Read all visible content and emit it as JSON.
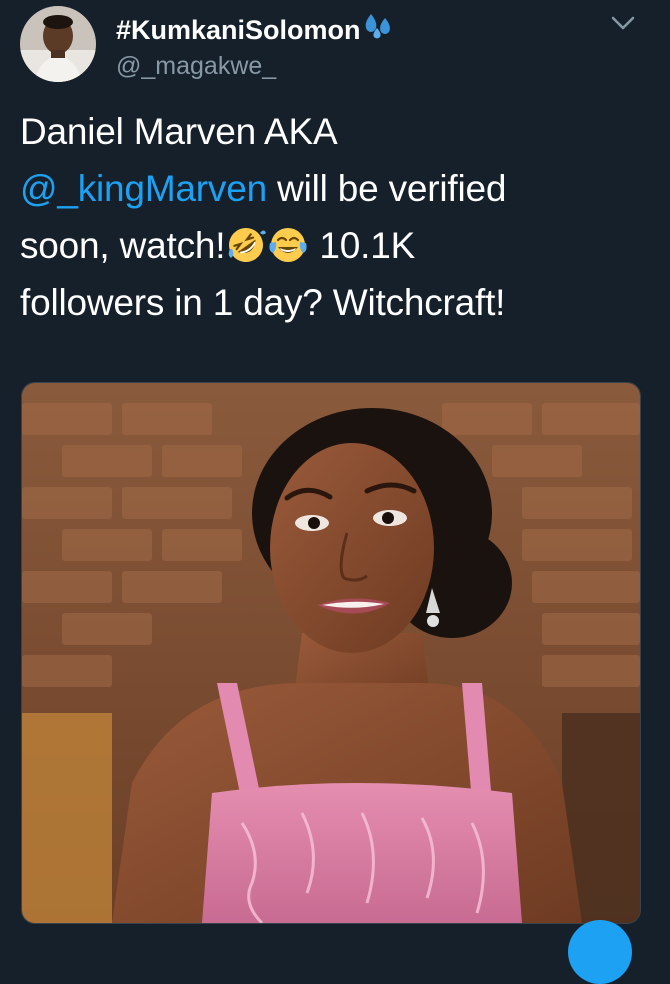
{
  "tweet": {
    "display_name": "#KumkaniSolomon",
    "display_name_icon": "sweat-droplets-icon",
    "handle": "@_magakwe_",
    "text": {
      "line1": "Daniel Marven AKA",
      "mention": "@_kingMarven",
      "line2_rest": " will be verified",
      "line3_start": "soon, watch!",
      "emoji1": "rolling-on-floor-laughing-icon",
      "emoji2": "face-with-tears-of-joy-icon",
      "line3_end": " 10.1K",
      "line4": "followers in 1 day? Witchcraft!"
    },
    "media": {
      "type": "photo",
      "subject": "woman-grimacing-photo"
    }
  },
  "colors": {
    "background": "#15202b",
    "text": "#ffffff",
    "secondary_text": "#8899a6",
    "link": "#1da1f2"
  }
}
